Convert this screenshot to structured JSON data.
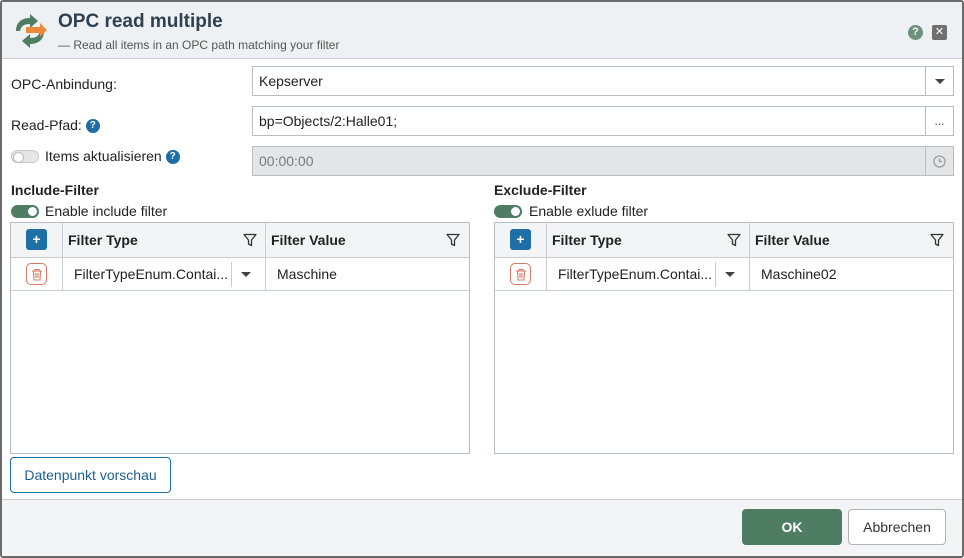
{
  "header": {
    "title": "OPC read multiple",
    "subtitle": "— Read all items in an OPC path matching your filter",
    "help_label": "?",
    "close_label": "✕"
  },
  "form": {
    "connection_label": "OPC-Anbindung:",
    "connection_value": "Kepserver",
    "read_path_label": "Read-Pfad:",
    "read_path_value": "bp=Objects/2:Halle01;",
    "read_path_button": "...",
    "refresh_label": "Items aktualisieren",
    "refresh_enabled": false,
    "refresh_interval": "00:00:00",
    "help_mark": "?"
  },
  "include_filter": {
    "title": "Include-Filter",
    "toggle_label": "Enable include filter",
    "enabled": true,
    "add_label": "+",
    "columns": [
      "Filter Type",
      "Filter Value"
    ],
    "rows": [
      {
        "type": "FilterTypeEnum.Contai...",
        "value": "Maschine"
      }
    ]
  },
  "exclude_filter": {
    "title": "Exclude-Filter",
    "toggle_label": "Enable exlude filter",
    "enabled": true,
    "add_label": "+",
    "columns": [
      "Filter Type",
      "Filter Value"
    ],
    "rows": [
      {
        "type": "FilterTypeEnum.Contai...",
        "value": "Maschine02"
      }
    ]
  },
  "preview_button": "Datenpunkt vorschau",
  "footer": {
    "ok_label": "OK",
    "cancel_label": "Abbrechen"
  },
  "colors": {
    "accent_green": "#4f7d64",
    "accent_blue": "#1d6fa5",
    "danger": "#d47a66"
  },
  "icons": {
    "app": "arrows-exchange-icon",
    "filter": "funnel-icon",
    "delete": "trash-icon",
    "dropdown": "caret-down-icon",
    "clock": "clock-icon"
  }
}
